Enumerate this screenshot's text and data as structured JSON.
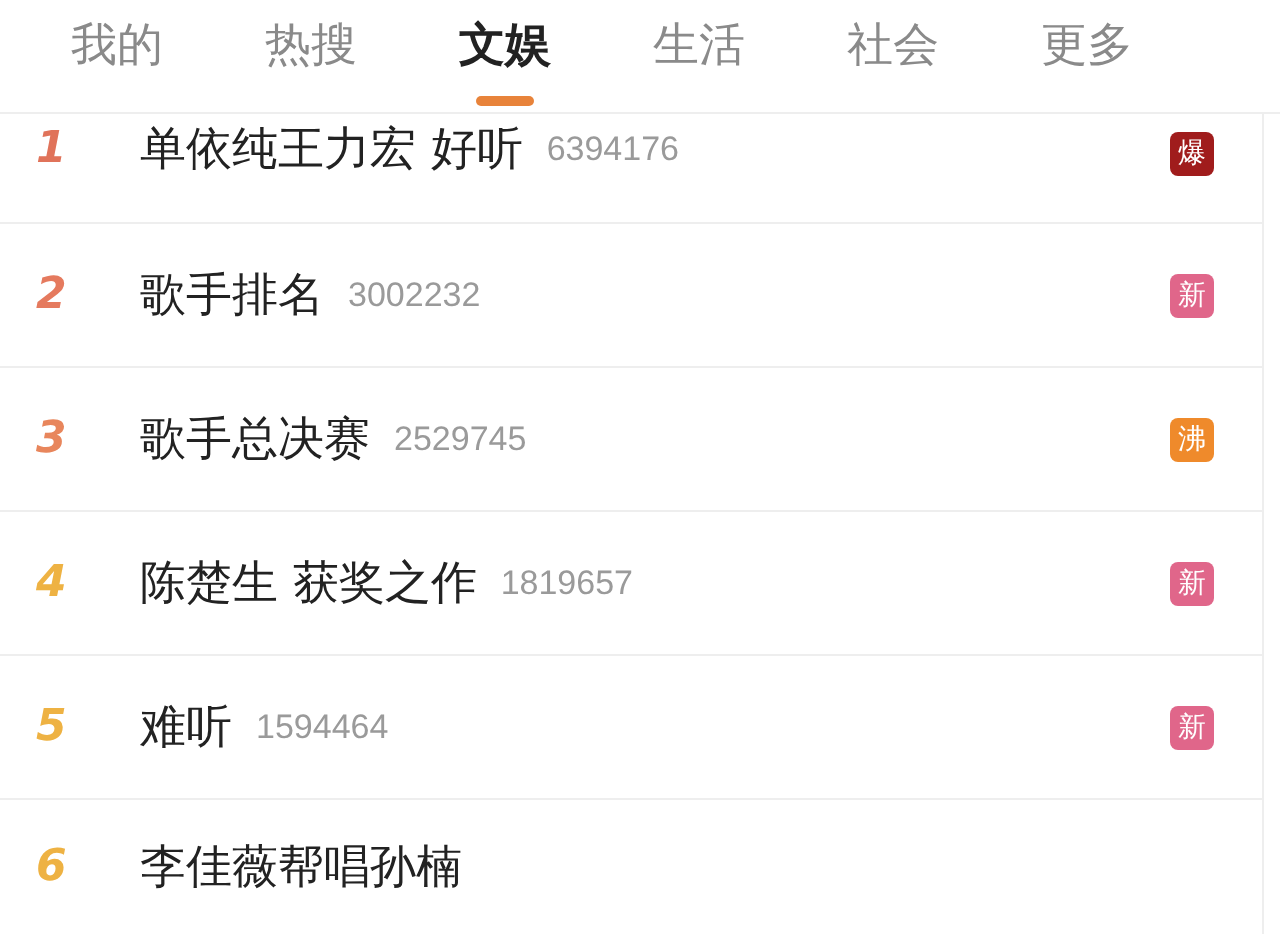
{
  "tabs": [
    {
      "label": "我的",
      "selected": false
    },
    {
      "label": "热搜",
      "selected": false
    },
    {
      "label": "文娱",
      "selected": true
    },
    {
      "label": "生活",
      "selected": false
    },
    {
      "label": "社会",
      "selected": false
    },
    {
      "label": "更多",
      "selected": false
    }
  ],
  "hot_list": [
    {
      "rank": "1",
      "color": "#e0735a",
      "title": "单依纯王力宏 好听",
      "count": "6394176",
      "badge": {
        "label": "爆",
        "color": "#a01c1c"
      }
    },
    {
      "rank": "2",
      "color": "#e57a5e",
      "title": "歌手排名",
      "count": "3002232",
      "badge": {
        "label": "新",
        "color": "#e0668a"
      }
    },
    {
      "rank": "3",
      "color": "#e8865c",
      "title": "歌手总决赛",
      "count": "2529745",
      "badge": {
        "label": "沸",
        "color": "#ef8a2b"
      }
    },
    {
      "rank": "4",
      "color": "#eeb243",
      "title": "陈楚生 获奖之作",
      "count": "1819657",
      "badge": {
        "label": "新",
        "color": "#e0668a"
      }
    },
    {
      "rank": "5",
      "color": "#eeb243",
      "title": "难听",
      "count": "1594464",
      "badge": {
        "label": "新",
        "color": "#e0668a"
      }
    },
    {
      "rank": "6",
      "color": "#eeb243",
      "title": "李佳薇帮唱孙楠"
    }
  ]
}
